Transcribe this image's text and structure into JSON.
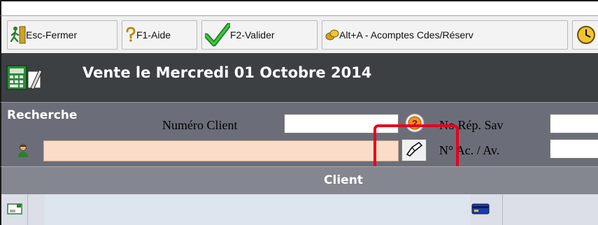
{
  "toolbar": {
    "esc_label": "Esc-Fermer",
    "help_label": "F1-Aide",
    "validate_label": "F2-Valider",
    "acomptes_label": "Alt+A - Acomptes  Cdes/Réserv"
  },
  "title": {
    "text": "Vente le Mercredi 01 Octobre 2014"
  },
  "search": {
    "section_label": "Recherche",
    "client_number_label": "Numéro Client",
    "client_number_value": "",
    "search_value": "",
    "rep_sav_label": "No Rép. Sav",
    "rep_sav_value": "",
    "ac_av_label": "N° Ac. / Av.",
    "ac_av_value": ""
  },
  "client": {
    "header_label": "Client"
  },
  "colors": {
    "title_bg": "#3c4043",
    "search_bg": "#6b6e78",
    "search_field_bg": "#fbdcc8",
    "highlight": "#e8001c",
    "client_header_bg": "#84878f",
    "client_row_bg": "#dde5ef"
  },
  "icons": {
    "esc": "running-man-exit-icon",
    "help": "question-mark-icon",
    "validate": "green-checkmark-icon",
    "acomptes": "coins-icon",
    "extra": "clock-icon",
    "title": "calculator-pencil-icon",
    "person": "person-icon",
    "help_round": "orange-help-icon",
    "card": "hand-card-icon",
    "client_left": "envelope-card-icon",
    "client_right": "credit-card-icon"
  }
}
